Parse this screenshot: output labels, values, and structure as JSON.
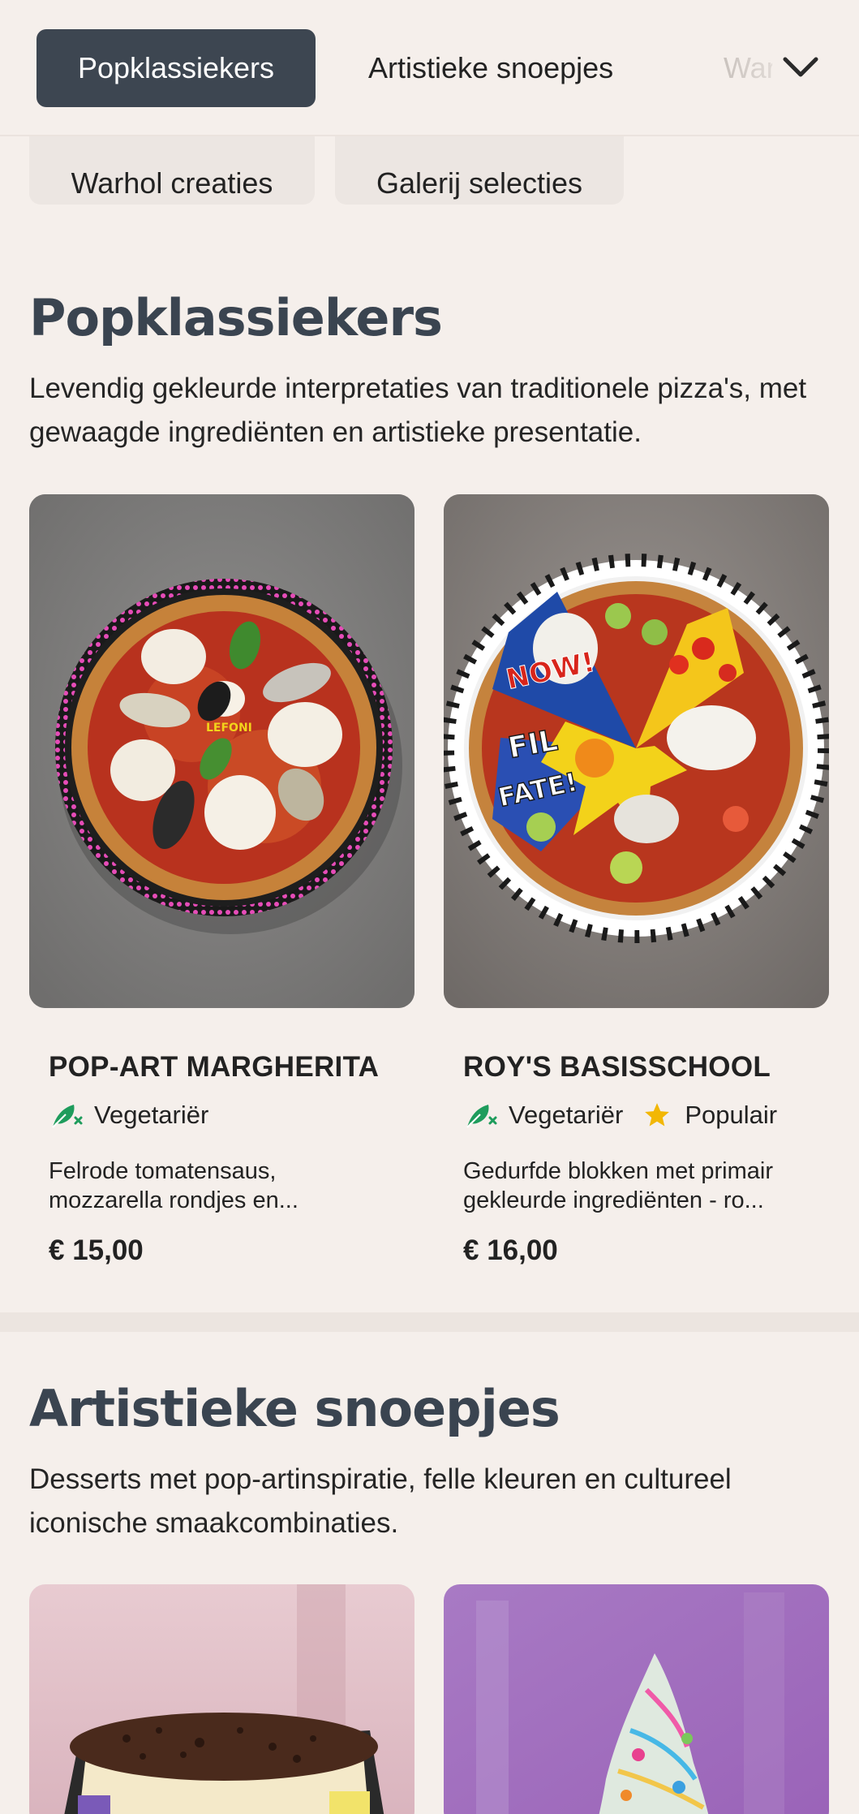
{
  "nav": {
    "tabs": [
      {
        "label": "Popklassiekers",
        "active": true
      },
      {
        "label": "Artistieke snoepjes",
        "active": false
      },
      {
        "label": "Warhol creaties",
        "active": false
      },
      {
        "label": "Galerij selecties",
        "active": false
      }
    ],
    "overflow_icon": "chevron-down-icon"
  },
  "sections": [
    {
      "title": "Popklassiekers",
      "description": "Levendig gekleurde interpretaties van traditionele pizza's, met gewaagde ingrediënten en artistieke presentatie.",
      "items": [
        {
          "name": "POP-ART MARGHERITA",
          "tags": [
            "Vegetariër"
          ],
          "description_line1": "Felrode tomatensaus,",
          "description_line2": "mozzarella rondjes en...",
          "price": "€ 15,00",
          "image_text": "LEFONI"
        },
        {
          "name": "ROY'S BASISSCHOOL",
          "tags": [
            "Vegetariër",
            "Populair"
          ],
          "description_line1": "Gedurfde blokken met primair",
          "description_line2": "gekleurde ingrediënten - ro...",
          "price": "€ 16,00",
          "image_text": [
            "NOW!",
            "FIL",
            "FATE!"
          ]
        }
      ]
    },
    {
      "title": "Artistieke snoepjes",
      "description": "Desserts met pop-artinspiratie, felle kleuren en cultureel iconische smaakcombinaties."
    }
  ],
  "colors": {
    "background": "#f5efeb",
    "active_tab": "#3d4651",
    "heading": "#3a4450",
    "vegetarian_icon": "#1e9c5c",
    "popular_icon": "#f2b705"
  }
}
